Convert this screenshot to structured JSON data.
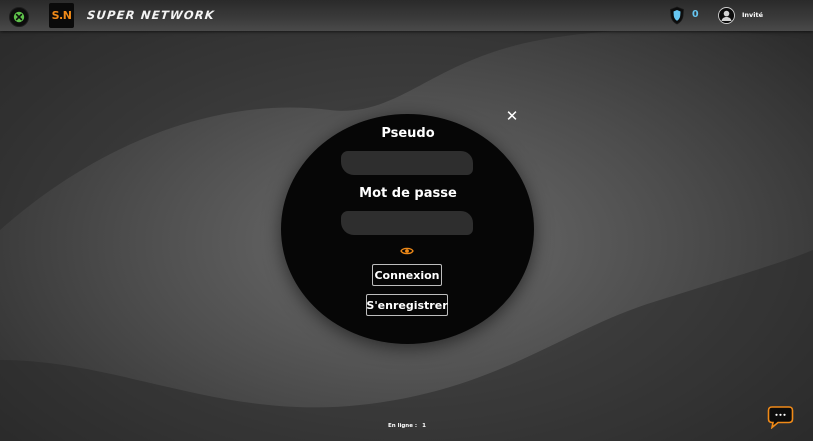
{
  "header": {
    "logo_text": "S.N",
    "brand_title": "SUPER NETWORK",
    "shield_count": "0",
    "user_name": "Invité"
  },
  "login": {
    "pseudo_label": "Pseudo",
    "pseudo_value": "",
    "password_label": "Mot de passe",
    "password_value": "",
    "close_glyph": "✕",
    "login_button": "Connexion",
    "register_button": "S'enregistrer"
  },
  "footer": {
    "online_label": "En ligne :",
    "online_count": "1"
  },
  "icons": {
    "menu": "close-circle-icon",
    "shield": "shield-icon",
    "user": "user-avatar-icon",
    "eye": "eye-icon",
    "chat": "chat-bubble-icon"
  },
  "colors": {
    "accent_orange": "#f08a18",
    "menu_green": "#5ec14a",
    "shield_blue": "#66c6f2",
    "login_bg": "#060606",
    "input_bg": "#2e2e2e"
  }
}
